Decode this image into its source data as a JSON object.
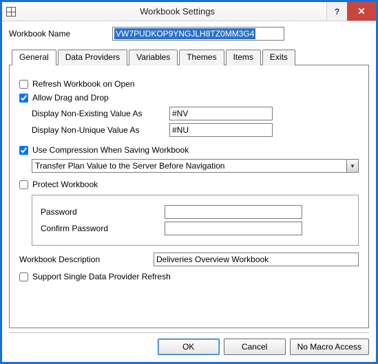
{
  "window": {
    "title": "Workbook Settings",
    "help_symbol": "?",
    "close_symbol": "✕"
  },
  "workbook_name": {
    "label": "Workbook Name",
    "value": "VW7PUDKOP9YNGJLH8TZ0MM3G4"
  },
  "tabs": {
    "general": "General",
    "data_providers": "Data Providers",
    "variables": "Variables",
    "themes": "Themes",
    "items": "Items",
    "exits": "Exits"
  },
  "general": {
    "refresh_on_open": "Refresh Workbook on Open",
    "allow_drag_drop": "Allow Drag and Drop",
    "non_existing_label": "Display Non-Existing Value As",
    "non_existing_value": "#NV",
    "non_unique_label": "Display Non-Unique Value As",
    "non_unique_value": "#NU",
    "use_compression": "Use Compression When Saving Workbook",
    "transfer_plan": "Transfer Plan Value to the Server Before Navigation",
    "protect_workbook": "Protect Workbook",
    "password_label": "Password",
    "confirm_password_label": "Confirm Password",
    "description_label": "Workbook Description",
    "description_value": "Deliveries Overview Workbook",
    "support_single": "Support Single Data Provider Refresh"
  },
  "buttons": {
    "ok": "OK",
    "cancel": "Cancel",
    "no_macro": "No Macro Access"
  }
}
